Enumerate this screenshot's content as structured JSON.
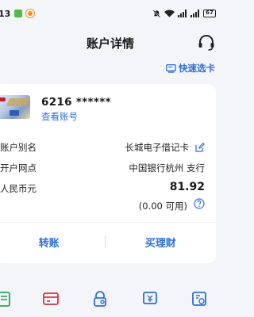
{
  "status_bar": {
    "time": "13",
    "battery": "67"
  },
  "header": {
    "title": "账户详情"
  },
  "quick_card": {
    "label": "快速选卡"
  },
  "account": {
    "card_number": "6216 ******",
    "view_account": "查看账号",
    "alias_label": "账户别名",
    "alias_value": "长城电子借记卡",
    "branch_label": "开户网点",
    "branch_value": "中国银行杭州                支行",
    "currency_label": "人民币元",
    "balance": "81.92",
    "available": "(0.00 可用)"
  },
  "actions": {
    "transfer": "转账",
    "wealth": "买理财"
  },
  "colors": {
    "accent": "#2f6fd6",
    "background": "#f3f5f8"
  }
}
